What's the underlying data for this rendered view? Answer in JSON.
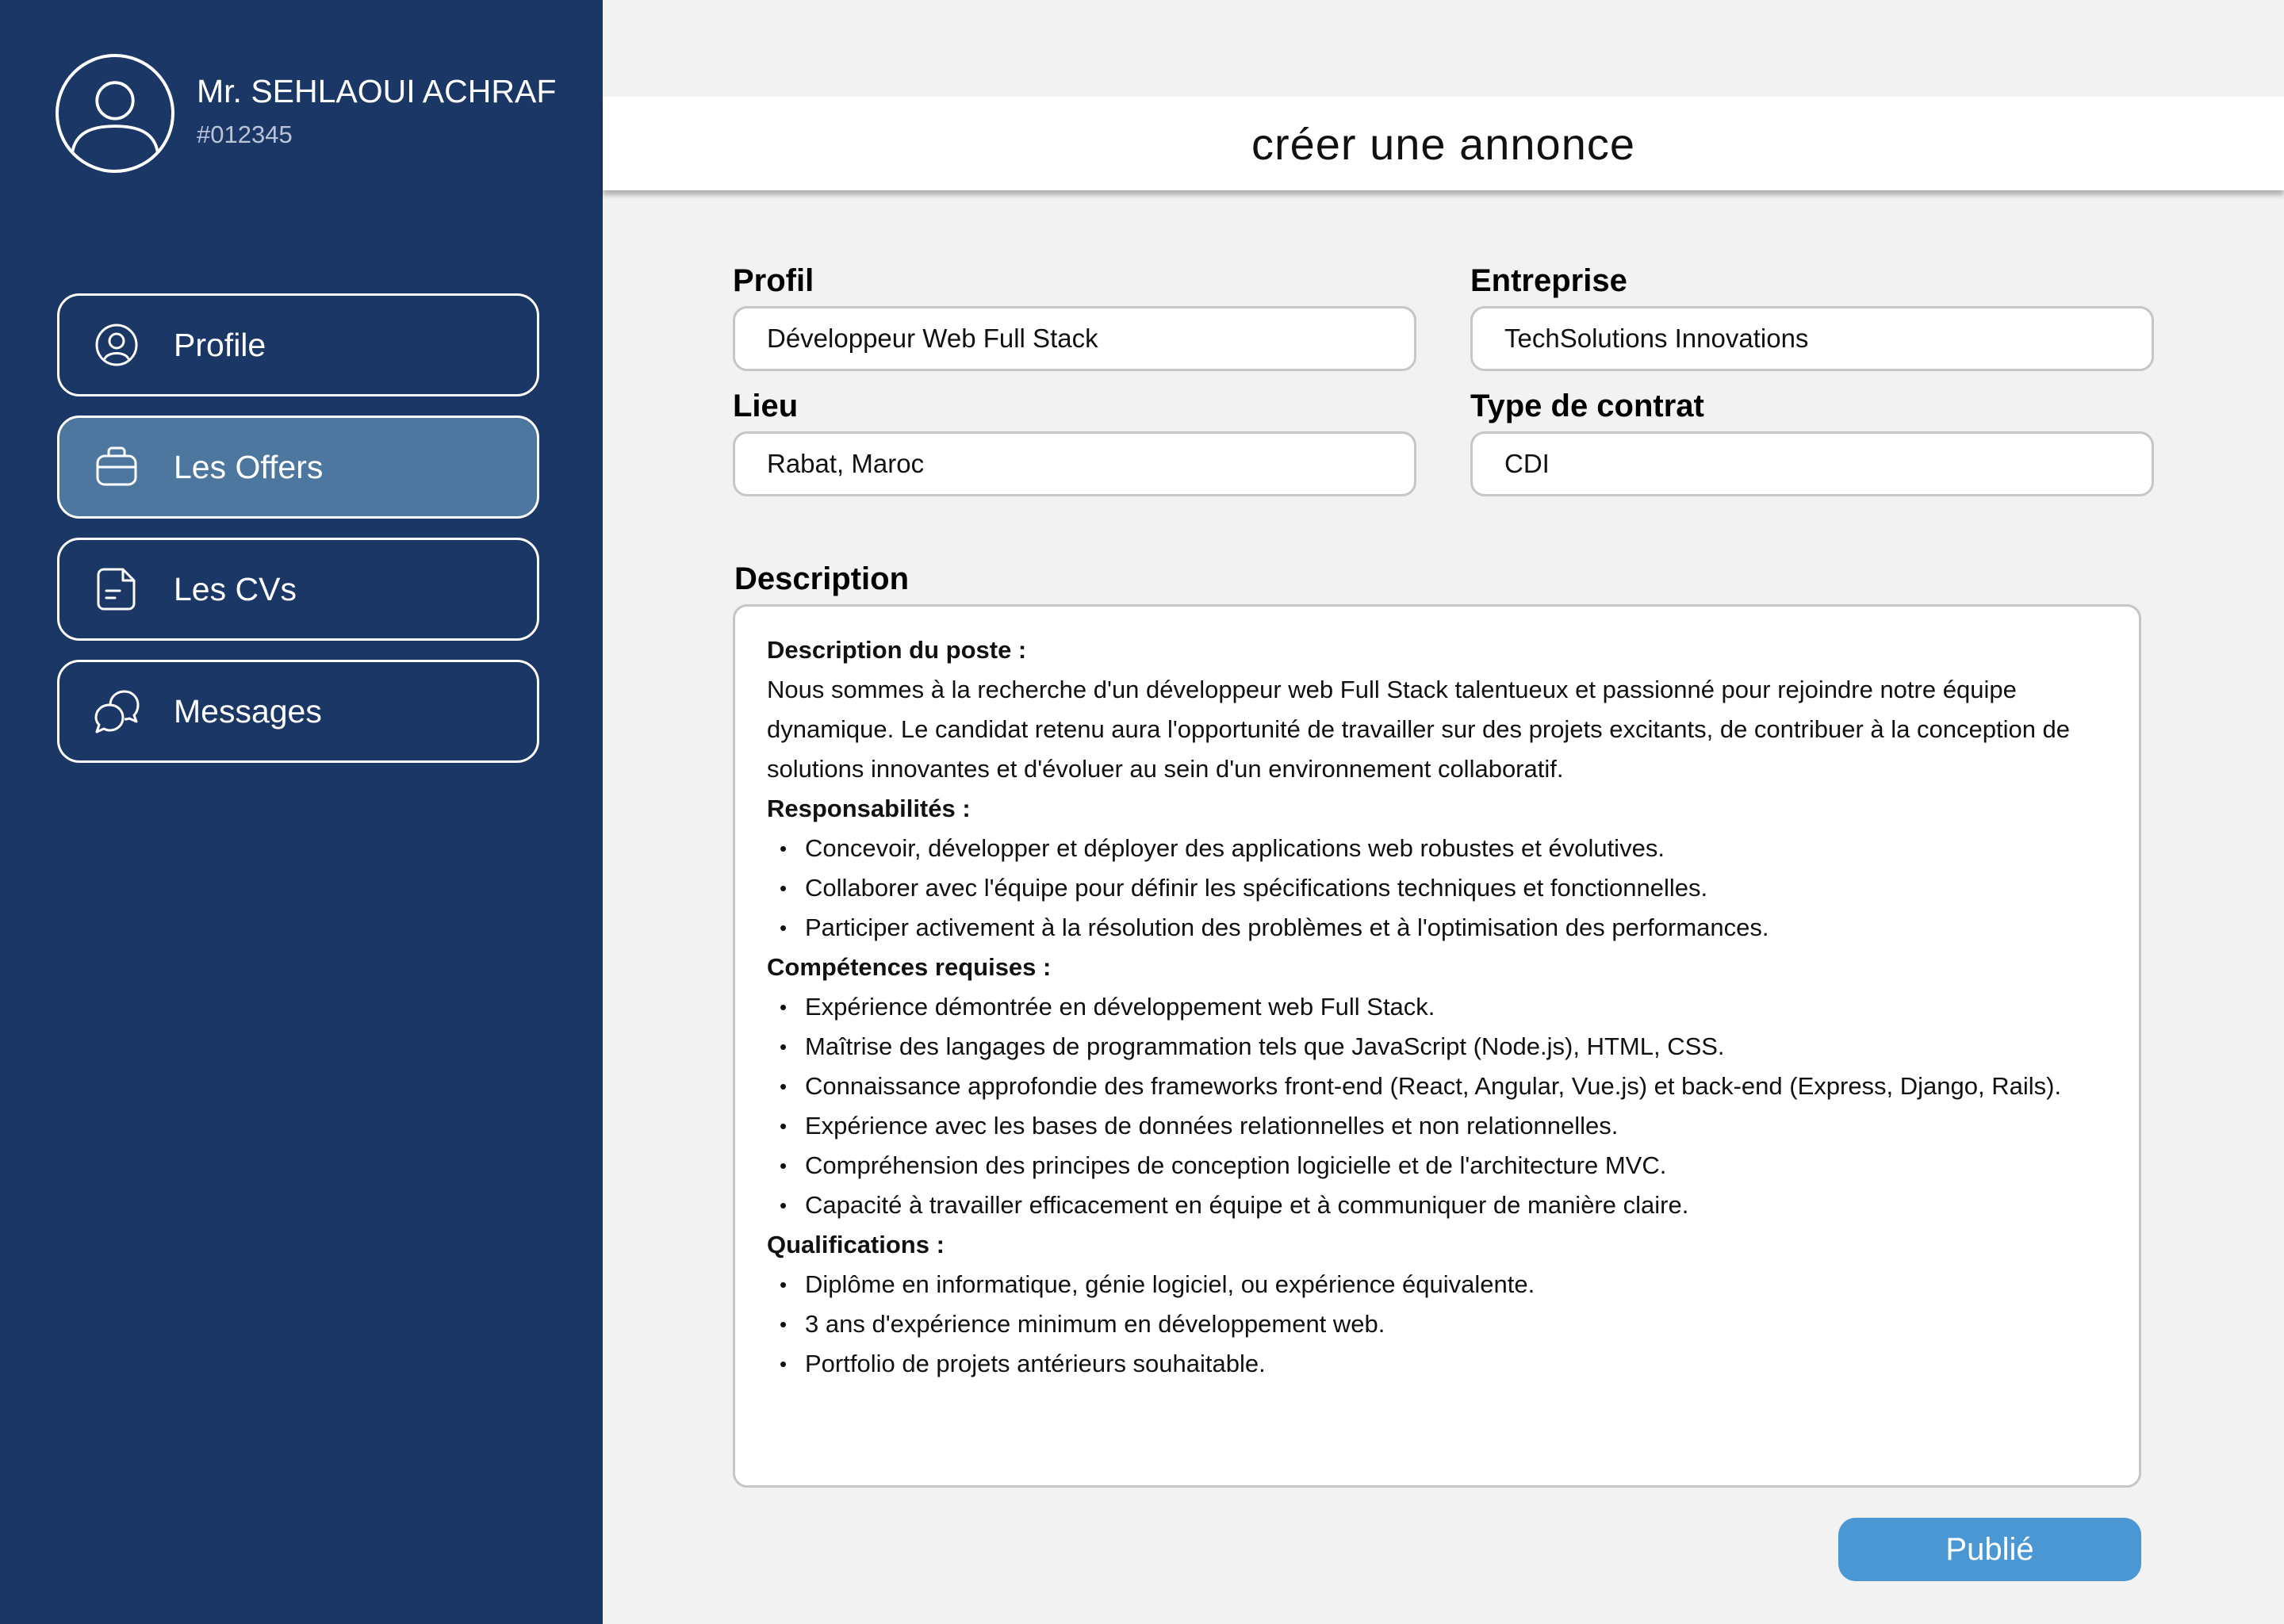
{
  "user": {
    "name": "Mr. SEHLAOUI ACHRAF",
    "id": "#012345",
    "avatar_icon": "user-avatar-icon"
  },
  "nav": {
    "items": [
      {
        "label": "Profile",
        "icon": "user-circle-icon",
        "active": false
      },
      {
        "label": "Les Offers",
        "icon": "briefcase-icon",
        "active": true
      },
      {
        "label": "Les CVs",
        "icon": "document-icon",
        "active": false
      },
      {
        "label": "Messages",
        "icon": "chat-bubbles-icon",
        "active": false
      }
    ]
  },
  "header": {
    "title": "créer une annonce"
  },
  "form": {
    "profil": {
      "label": "Profil",
      "value": "Développeur Web Full Stack"
    },
    "entreprise": {
      "label": "Entreprise",
      "value": "TechSolutions Innovations"
    },
    "lieu": {
      "label": "Lieu",
      "value": "Rabat, Maroc"
    },
    "contrat": {
      "label": "Type de contrat",
      "value": "CDI"
    },
    "description": {
      "label": "Description",
      "poste_title": "Description du poste :",
      "poste_text": "Nous sommes à la recherche d'un développeur web Full Stack talentueux et passionné pour rejoindre notre équipe dynamique. Le candidat retenu aura l'opportunité de travailler sur des projets excitants, de contribuer à la conception de solutions innovantes et d'évoluer au sein d'un environnement collaboratif.",
      "resp_title": "Responsabilités :",
      "resp_items": [
        "Concevoir, développer et déployer des applications web robustes et évolutives.",
        "Collaborer avec l'équipe pour définir les spécifications techniques et fonctionnelles.",
        "Participer activement à la résolution des problèmes et à l'optimisation des performances."
      ],
      "comp_title": "Compétences requises :",
      "comp_items": [
        "Expérience démontrée en développement web Full Stack.",
        "Maîtrise des langages de programmation tels que JavaScript (Node.js), HTML, CSS.",
        "Connaissance approfondie des frameworks front-end (React, Angular, Vue.js) et back-end (Express, Django, Rails).",
        "Expérience avec les bases de données relationnelles et non relationnelles.",
        "Compréhension des principes de conception logicielle et de l'architecture MVC.",
        "Capacité à travailler efficacement en équipe et à communiquer de manière claire."
      ],
      "qual_title": "Qualifications :",
      "qual_items": [
        "Diplôme en informatique, génie logiciel, ou expérience équivalente.",
        "3 ans d'expérience minimum en développement web.",
        "Portfolio de projets antérieurs souhaitable."
      ]
    }
  },
  "actions": {
    "publish_label": "Publié"
  },
  "colors": {
    "sidebar_bg": "#1b3766",
    "active_item_bg": "#4d779f",
    "publish_button": "#4a97d4",
    "page_bg": "#f2f2f2"
  }
}
